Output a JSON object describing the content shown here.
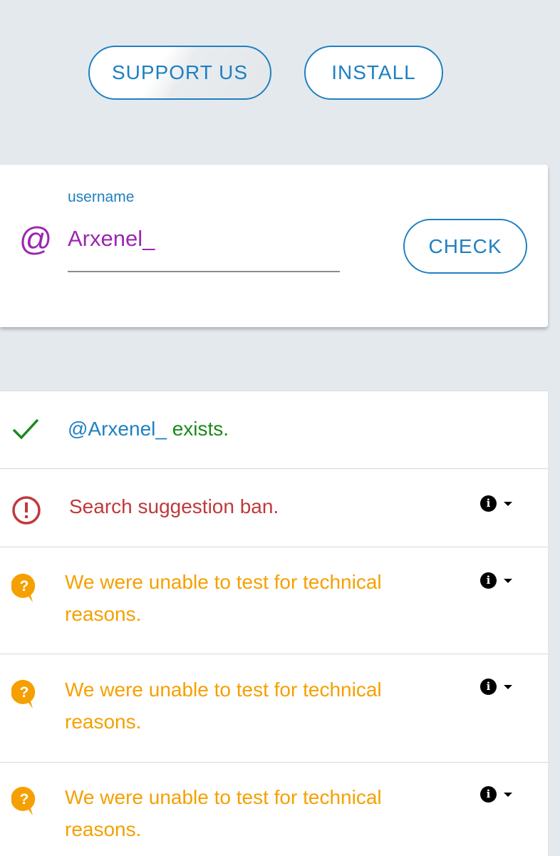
{
  "header": {
    "support_label": "SUPPORT US",
    "install_label": "INSTALL"
  },
  "search": {
    "field_label": "username",
    "at_symbol": "@",
    "value": "Arxenel_",
    "check_label": "CHECK"
  },
  "results": {
    "exists": {
      "handle": "@Arxenel_",
      "status": " exists."
    },
    "suggestion_ban": {
      "text": "Search suggestion ban."
    },
    "unable_rows": [
      {
        "line1": "We were unable to test for technical",
        "line2": "reasons."
      },
      {
        "line1": "We were unable to test for technical",
        "line2": "reasons."
      },
      {
        "line1": "We were unable to test for technical",
        "line2": "reasons."
      }
    ],
    "info_glyph": "i"
  },
  "colors": {
    "accent_blue": "#1f80c1",
    "username_purple": "#9c27b0",
    "success_green": "#1a8a1a",
    "error_red": "#c0393b",
    "warning_orange": "#f5a000",
    "background": "#e4e9ee"
  },
  "icons": {
    "row_1": "check-icon",
    "row_2": "alert-circle-icon",
    "row_3_to_5": "question-bubble-icon",
    "row_actions": [
      "info-icon",
      "caret-down-icon"
    ]
  }
}
